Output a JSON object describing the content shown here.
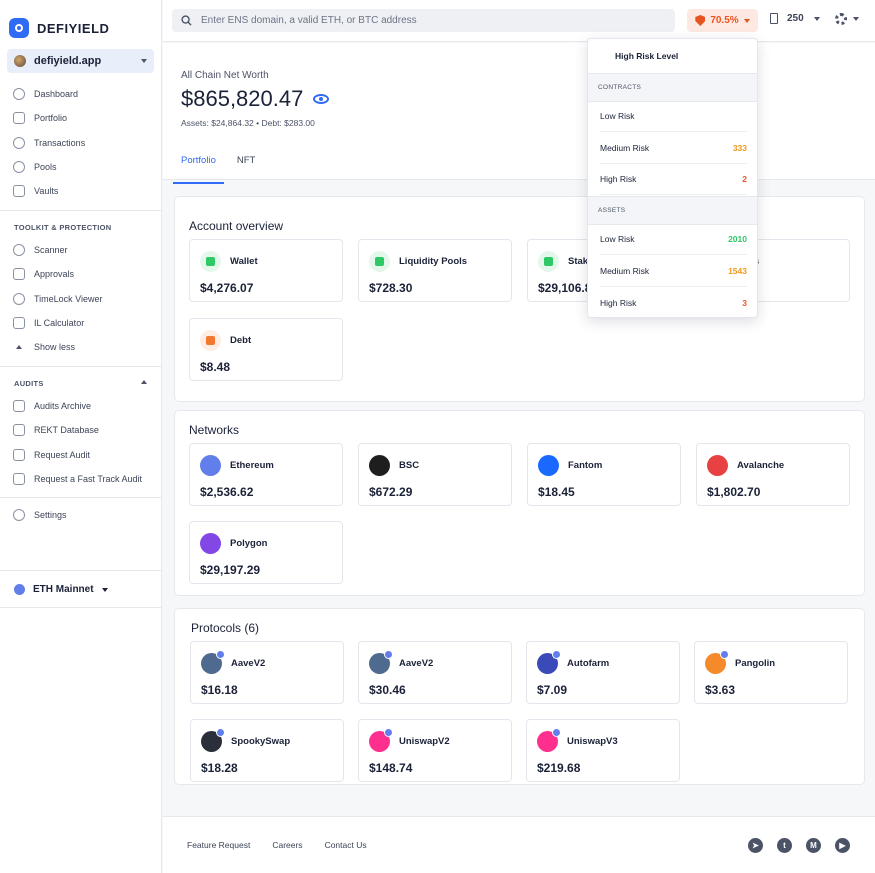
{
  "app": {
    "name": "DEFIYIELD",
    "account": "defiyield.app"
  },
  "sidebar": {
    "main_items": [
      {
        "label": "Dashboard",
        "icon": "dashboard-icon"
      },
      {
        "label": "Portfolio",
        "icon": "portfolio-icon"
      },
      {
        "label": "Transactions",
        "icon": "transactions-icon"
      },
      {
        "label": "Pools",
        "icon": "pools-icon"
      },
      {
        "label": "Vaults",
        "icon": "vaults-icon"
      }
    ],
    "toolkit_title": "TOOLKIT & PROTECTION",
    "toolkit_items": [
      {
        "label": "Scanner",
        "icon": "scanner-icon"
      },
      {
        "label": "Approvals",
        "icon": "approvals-icon"
      },
      {
        "label": "TimeLock Viewer",
        "icon": "timelock-icon"
      },
      {
        "label": "IL Calculator",
        "icon": "calculator-icon"
      }
    ],
    "show_less": "Show less",
    "audits_title": "AUDITS",
    "audits_items": [
      {
        "label": "Audits Archive",
        "icon": "archive-icon"
      },
      {
        "label": "REKT Database",
        "icon": "database-icon"
      },
      {
        "label": "Request Audit",
        "icon": "request-icon"
      },
      {
        "label": "Request a Fast Track Audit",
        "icon": "fast-track-icon"
      }
    ],
    "settings": "Settings",
    "network": "ETH Mainnet"
  },
  "topbar": {
    "search_placeholder": "Enter ENS domain, a valid ETH, or BTC address",
    "risk_score": "70.5%",
    "gas": "250"
  },
  "header": {
    "label": "All Chain Net Worth",
    "net_worth": "$865,820.47",
    "assets_debt": "Assets: $24,864.32  •  Debt: $283.00",
    "tabs": [
      "Portfolio",
      "NFT"
    ]
  },
  "account_overview": {
    "title": "Account overview",
    "cards": [
      {
        "name": "Wallet",
        "value": "$4,276.07",
        "color": "#2ec866"
      },
      {
        "name": "Liquidity Pools",
        "value": "$728.30",
        "color": "#2ec866"
      },
      {
        "name": "Stak",
        "value": "$29,106.8",
        "color": "#2ec866"
      },
      {
        "name": "osits",
        "value": "",
        "color": "#2ec866"
      },
      {
        "name": "Debt",
        "value": "$8.48",
        "color": "#f2782f"
      }
    ]
  },
  "networks": {
    "title": "Networks",
    "cards": [
      {
        "name": "Ethereum",
        "value": "$2,536.62",
        "color": "#627eea"
      },
      {
        "name": "BSC",
        "value": "$672.29",
        "color": "#1e1e1e"
      },
      {
        "name": "Fantom",
        "value": "$18.45",
        "color": "#1969ff"
      },
      {
        "name": "Avalanche",
        "value": "$1,802.70",
        "color": "#e84142"
      },
      {
        "name": "Polygon",
        "value": "$29,197.29",
        "color": "#8247e5"
      }
    ]
  },
  "protocols": {
    "title": "Protocols (6)",
    "cards": [
      {
        "name": "AaveV2",
        "value": "$16.18",
        "color": "#4f6a8f"
      },
      {
        "name": "AaveV2",
        "value": "$30.46",
        "color": "#4f6a8f"
      },
      {
        "name": "Autofarm",
        "value": "$7.09",
        "color": "#3a4ab8"
      },
      {
        "name": "Pangolin",
        "value": "$3.63",
        "color": "#f58a2a"
      },
      {
        "name": "SpookySwap",
        "value": "$18.28",
        "color": "#2b2f3a"
      },
      {
        "name": "UniswapV2",
        "value": "$148.74",
        "color": "#ff2f8f"
      },
      {
        "name": "UniswapV3",
        "value": "$219.68",
        "color": "#ff2f8f"
      }
    ]
  },
  "risk_dropdown": {
    "title": "High Risk Level",
    "contracts_title": "CONTRACTS",
    "contracts": [
      {
        "label": "Low Risk",
        "value": ""
      },
      {
        "label": "Medium Risk",
        "value": "333",
        "color": "#f29a1d"
      },
      {
        "label": "High Risk",
        "value": "2",
        "color": "#f0541f"
      }
    ],
    "assets_title": "ASSETS",
    "assets": [
      {
        "label": "Low Risk",
        "value": "2010",
        "color": "#2ec866"
      },
      {
        "label": "Medium Risk",
        "value": "1543",
        "color": "#f29a1d"
      },
      {
        "label": "High Risk",
        "value": "3",
        "color": "#f0541f"
      }
    ]
  },
  "footer": {
    "links": [
      "Feature Request",
      "Careers",
      "Contact Us"
    ],
    "socials": [
      {
        "name": "telegram-icon",
        "glyph": "➤"
      },
      {
        "name": "twitter-icon",
        "glyph": "t"
      },
      {
        "name": "medium-icon",
        "glyph": "M"
      },
      {
        "name": "youtube-icon",
        "glyph": "▶"
      }
    ]
  }
}
